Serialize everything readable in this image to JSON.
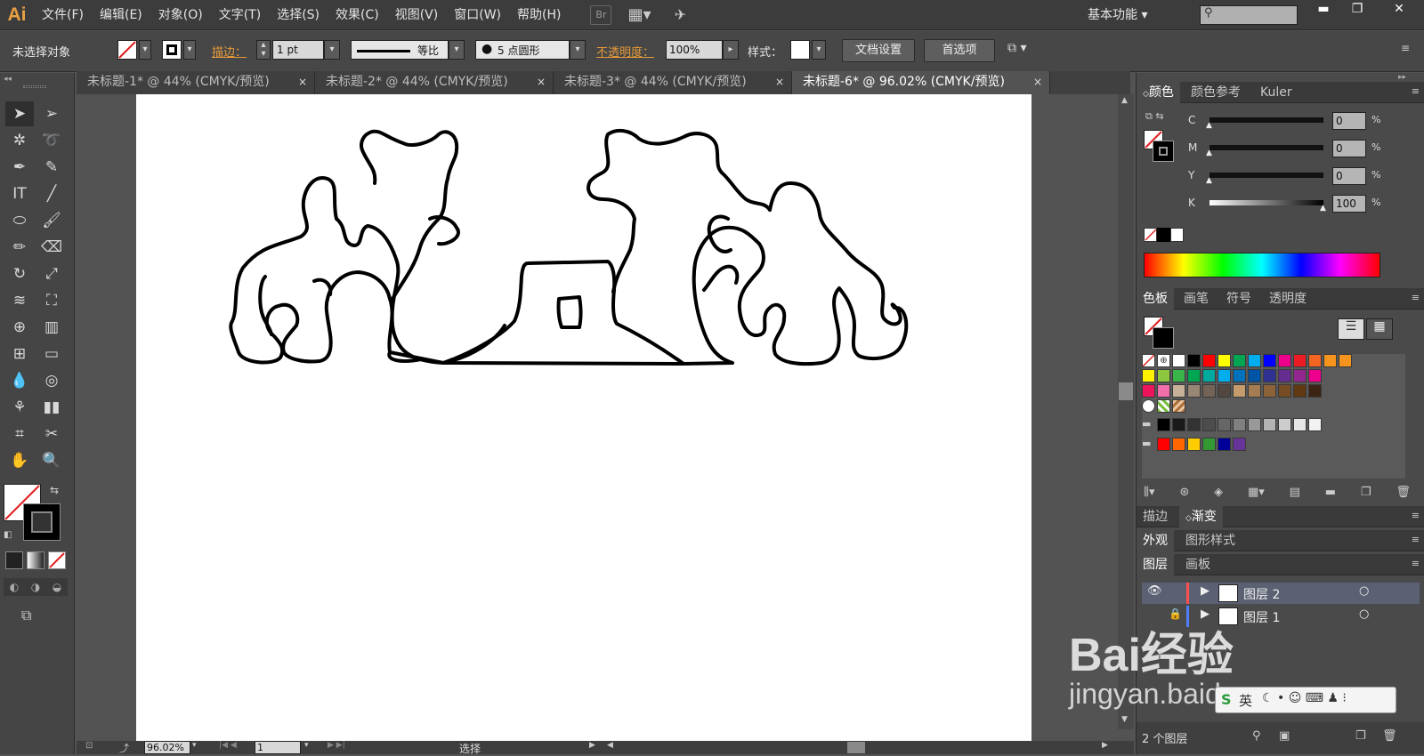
{
  "app": {
    "logo": "Ai"
  },
  "menu": [
    "文件(F)",
    "编辑(E)",
    "对象(O)",
    "文字(T)",
    "选择(S)",
    "效果(C)",
    "视图(V)",
    "窗口(W)",
    "帮助(H)"
  ],
  "menubar_icons": {
    "bridge": "Br"
  },
  "workspace": "基本功能",
  "control": {
    "selection": "未选择对象",
    "stroke_label": "描边：",
    "stroke_value": "1 pt",
    "profile": "等比",
    "brush": "5 点圆形",
    "opacity_label": "不透明度：",
    "opacity_value": "100%",
    "style_label": "样式：",
    "doc_setup": "文档设置",
    "prefs": "首选项"
  },
  "tabs": [
    {
      "label": "未标题-1* @ 44% (CMYK/预览)",
      "close": "×"
    },
    {
      "label": "未标题-2* @ 44% (CMYK/预览)",
      "close": "×"
    },
    {
      "label": "未标题-3* @ 44% (CMYK/预览)",
      "close": "×"
    },
    {
      "label": "未标题-6* @ 96.02% (CMYK/预览)",
      "close": "×"
    }
  ],
  "status": {
    "zoom": "96.02%",
    "page": "1",
    "mode": "选择"
  },
  "color_panel": {
    "tabs": [
      "颜色",
      "颜色参考",
      "Kuler"
    ],
    "channels": [
      {
        "label": "C",
        "value": "0",
        "fill": 0
      },
      {
        "label": "M",
        "value": "0",
        "fill": 0
      },
      {
        "label": "Y",
        "value": "0",
        "fill": 0
      },
      {
        "label": "K",
        "value": "100",
        "fill": 1
      }
    ],
    "unit": "%"
  },
  "swatch_panel": {
    "tabs": [
      "色板",
      "画笔",
      "符号",
      "透明度"
    ],
    "rows": [
      [
        "#ffffff",
        "#000000",
        "#ff0000",
        "#ffff00",
        "#00a651",
        "#00aeef",
        "#0000ff",
        "#ec008c",
        "#ed1c24",
        "#f26522",
        "#f7941d",
        "#f7941d"
      ],
      [
        "#fff200",
        "#8dc63f",
        "#39b54a",
        "#00a651",
        "#00a99d",
        "#00aeef",
        "#0072bc",
        "#0054a6",
        "#2e3192",
        "#662d91",
        "#92278f",
        "#ec008c"
      ],
      [
        "#ed145b",
        "#f06eaa",
        "#c7b299",
        "#998675",
        "#736357",
        "#534741",
        "#c69c6d",
        "#a67c52",
        "#8c6239",
        "#754c24",
        "#603913",
        "#3c2415"
      ],
      [
        "#000000",
        "#1a1a1a",
        "#333333",
        "#4d4d4d",
        "#666666",
        "#808080",
        "#999999",
        "#b3b3b3",
        "#cccccc",
        "#e6e6e6",
        "#f2f2f2"
      ],
      [
        "#ff0000",
        "#ff6600",
        "#ffcc00",
        "#339933",
        "#000099",
        "#663399"
      ]
    ]
  },
  "stroke_panel": {
    "tabs": [
      "描边",
      "渐变"
    ]
  },
  "appearance_panel": {
    "tabs": [
      "外观",
      "图形样式"
    ]
  },
  "layers_panel": {
    "tabs": [
      "图层",
      "画板"
    ],
    "layers": [
      {
        "name": "图层 2",
        "color": "#ff4f4f"
      },
      {
        "name": "图层 1",
        "color": "#4f7fff"
      }
    ],
    "footer": "2 个图层"
  },
  "watermark": {
    "brand": "Bai经验",
    "url": "jingyan.baidu.com",
    "ime": "英"
  },
  "colors": {
    "menubar": "#3c3c3c",
    "ctrlbar": "#474747",
    "accent": "#e69a3b"
  }
}
